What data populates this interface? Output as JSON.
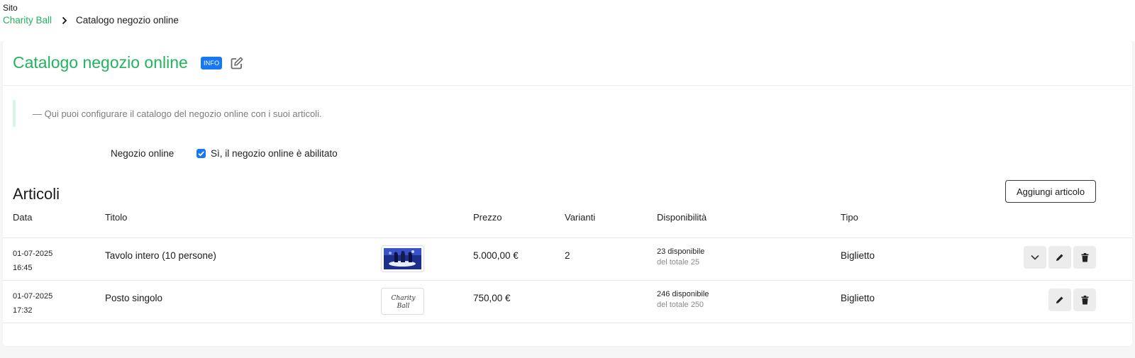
{
  "header": {
    "site_label": "Sito",
    "breadcrumb": {
      "parent": "Charity Ball",
      "current": "Catalogo negozio online"
    }
  },
  "page": {
    "title": "Catalogo negozio online",
    "info_badge": "INFO",
    "description": "— Qui puoi configurare il catalogo del negozio online con i suoi articoli."
  },
  "settings": {
    "shop_label": "Negozio online",
    "shop_checkbox_label": "Sì, il negozio online è abilitato",
    "shop_enabled": true
  },
  "articles": {
    "section_title": "Articoli",
    "add_button": "Aggiungi articolo",
    "columns": {
      "date": "Data",
      "title": "Titolo",
      "price": "Prezzo",
      "variants": "Varianti",
      "availability": "Disponibilità",
      "type": "Tipo"
    },
    "rows": [
      {
        "date": "01-07-2025",
        "time": "16:45",
        "title": "Tavolo intero (10 persone)",
        "price": "5.000,00 €",
        "variants": "2",
        "available": "23 disponibile",
        "total": "del totale 25",
        "type": "Biglietto"
      },
      {
        "date": "01-07-2025",
        "time": "17:32",
        "title": "Posto singolo",
        "price": "750,00 €",
        "variants": "",
        "available": "246 disponibile",
        "total": "del totale 250",
        "type": "Biglietto",
        "thumbnail_text": "Charity Ball"
      }
    ]
  },
  "colors": {
    "brand_green": "#22b35e",
    "info_blue": "#1877f2",
    "callout_border": "#d7f5e2"
  }
}
